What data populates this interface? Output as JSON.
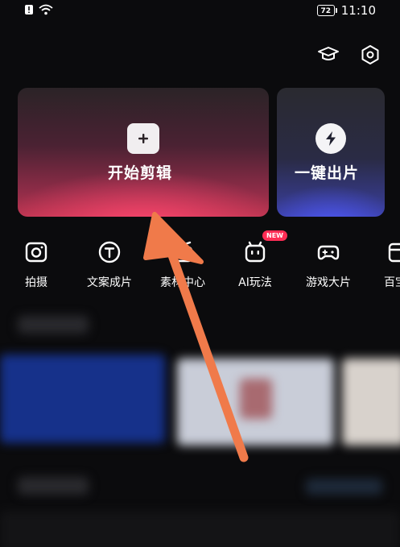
{
  "status_bar": {
    "battery": "72",
    "time": "11:10"
  },
  "top_icons": {
    "learn": "graduation-cap-icon",
    "settings": "settings-hex-icon"
  },
  "cards": {
    "start_edit_label": "开始剪辑",
    "one_click_label": "一键出片"
  },
  "features": [
    {
      "label": "拍摄",
      "icon": "camera-icon"
    },
    {
      "label": "文案成片",
      "icon": "text-t-icon"
    },
    {
      "label": "素材中心",
      "icon": "material-icon"
    },
    {
      "label": "AI玩法",
      "icon": "robot-icon"
    },
    {
      "label": "游戏大片",
      "icon": "gamepad-icon"
    },
    {
      "label": "百宝",
      "icon": "box-icon"
    }
  ],
  "badge": {
    "new": "NEW"
  },
  "colors": {
    "annotation_arrow": "#f07a4a",
    "main_card_glow": "#ff466e",
    "side_card_glow": "#505aff"
  }
}
